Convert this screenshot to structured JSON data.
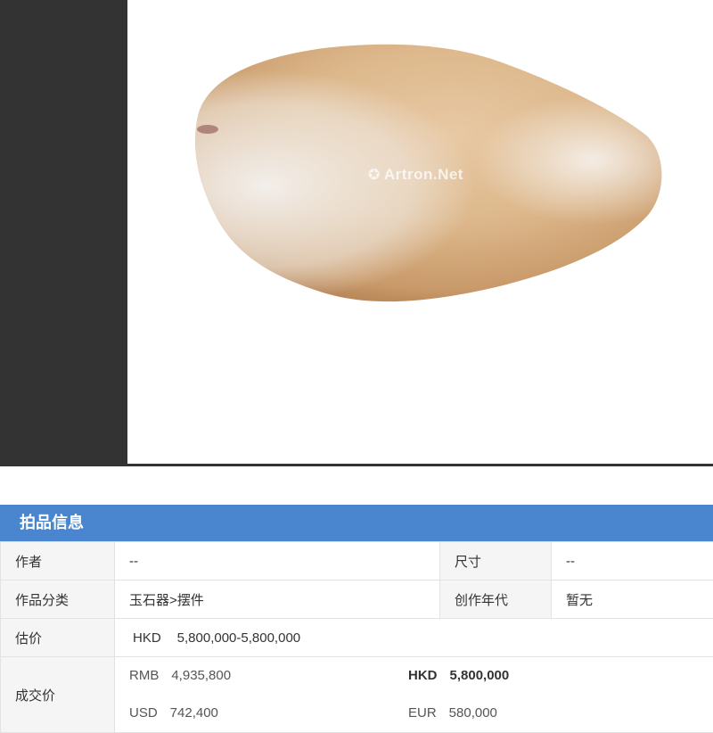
{
  "viewer": {
    "image_alt": "玉石器摆件",
    "watermark": "Artron.Net",
    "colors": {
      "side_panel": "#333333",
      "background": "#ffffff"
    }
  },
  "info": {
    "title": "拍品信息",
    "header_color": "#4a86cf",
    "rows": {
      "author_label": "作者",
      "author_value": "--",
      "size_label": "尺寸",
      "size_value": "--",
      "category_label": "作品分类",
      "category_value": "玉石器>摆件",
      "year_label": "创作年代",
      "year_value": "暂无",
      "estimate_label": "估价",
      "estimate_currency": "HKD",
      "estimate_value": "5,800,000-5,800,000",
      "deal_label": "成交价"
    },
    "deal_prices": [
      {
        "currency": "RMB",
        "amount": "4,935,800"
      },
      {
        "currency": "HKD",
        "amount": "5,800,000"
      },
      {
        "currency": "USD",
        "amount": "742,400"
      },
      {
        "currency": "EUR",
        "amount": "580,000"
      }
    ],
    "estimate_color": "#e60012"
  }
}
